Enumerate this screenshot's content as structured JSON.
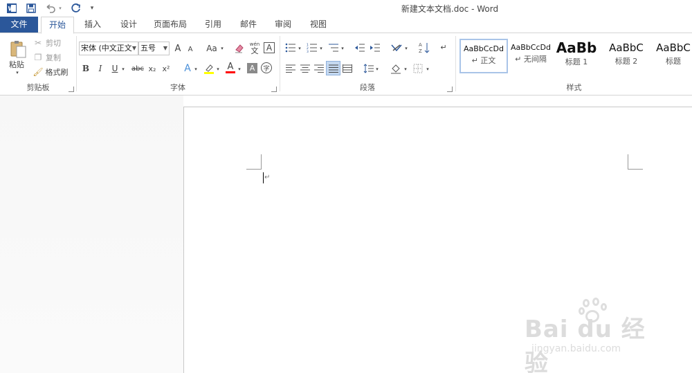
{
  "window": {
    "title": "新建文本文档.doc - Word",
    "app_icon": "word-icon",
    "qat": [
      "save-icon",
      "undo-icon",
      "redo-icon",
      "customize-icon"
    ]
  },
  "tabs": [
    {
      "label": "文件"
    },
    {
      "label": "开始"
    },
    {
      "label": "插入"
    },
    {
      "label": "设计"
    },
    {
      "label": "页面布局"
    },
    {
      "label": "引用"
    },
    {
      "label": "邮件"
    },
    {
      "label": "审阅"
    },
    {
      "label": "视图"
    }
  ],
  "active_tab": "开始",
  "ribbon": {
    "clipboard": {
      "label": "剪贴板",
      "paste": "粘贴",
      "cut": "剪切",
      "copy": "复制",
      "format_painter": "格式刷"
    },
    "font": {
      "label": "字体",
      "font_name": "宋体 (中文正文",
      "font_size": "五号",
      "wen_glyph": "wén",
      "wen_char": "文",
      "frame_char": "A",
      "circle_char": "字",
      "buttons": [
        "A",
        "A",
        "Aa",
        "B",
        "I",
        "U",
        "abc",
        "x₂",
        "x²",
        "A",
        "A",
        "A"
      ]
    },
    "paragraph": {
      "label": "段落"
    },
    "styles": {
      "label": "样式",
      "items": [
        {
          "preview": "AaBbCcDd",
          "name": "↵ 正文",
          "selected": true
        },
        {
          "preview": "AaBbCcDd",
          "name": "↵ 无间隔",
          "selected": false
        },
        {
          "preview": "AaBb",
          "name": "标题 1",
          "selected": false
        },
        {
          "preview": "AaBbC",
          "name": "标题 2",
          "selected": false
        },
        {
          "preview": "AaBbC",
          "name": "标题",
          "selected": false
        }
      ]
    }
  },
  "document": {
    "paragraph_mark": "↵"
  },
  "watermark": {
    "logo": "Bai du 经验",
    "url": "jingyan.baidu.com"
  },
  "colors": {
    "accent": "#2b579a",
    "highlight": "#ffff00",
    "font_color": "#ff0000"
  }
}
